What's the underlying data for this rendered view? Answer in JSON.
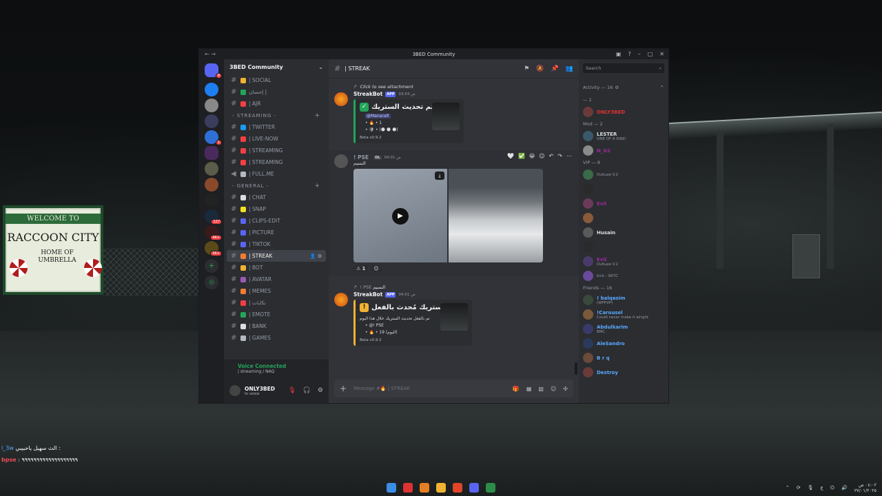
{
  "window": {
    "title": "3BED Community"
  },
  "background_sign": {
    "welcome": "WELCOME TO",
    "city": "RACCOON CITY",
    "home": "HOME OF UMBRELLA"
  },
  "channels": {
    "server_name": "3BED Community",
    "items": [
      {
        "kind": "channel",
        "label": "| SOCIAL",
        "color": "#f0b232"
      },
      {
        "kind": "channel",
        "label": "إحسان |",
        "color": "#23a55a"
      },
      {
        "kind": "channel",
        "label": "| AJR",
        "color": "#f23f43"
      },
      {
        "kind": "category",
        "label": "- STREAMING -"
      },
      {
        "kind": "channel",
        "label": "| TWITTER",
        "color": "#1d9bf0"
      },
      {
        "kind": "channel",
        "label": "| LIVE-NOW",
        "color": "#f23f43"
      },
      {
        "kind": "channel",
        "label": "| STREAMING",
        "color": "#f23f43"
      },
      {
        "kind": "channel",
        "label": "| STREAMING",
        "color": "#f23f43"
      },
      {
        "kind": "voice",
        "label": "| FULL.ME",
        "color": "#b5bac1"
      },
      {
        "kind": "category",
        "label": "- GENERAL -"
      },
      {
        "kind": "channel",
        "label": "| CHAT",
        "color": "#dbdee1"
      },
      {
        "kind": "channel",
        "label": "| SNAP",
        "color": "#f0e020"
      },
      {
        "kind": "channel",
        "label": "| CLIPS-EDIT",
        "color": "#5865f2"
      },
      {
        "kind": "channel",
        "label": "| PICTURE",
        "color": "#5865f2"
      },
      {
        "kind": "channel",
        "label": "| TIKTOK",
        "color": "#5865f2"
      },
      {
        "kind": "channel",
        "label": "| STREAK",
        "color": "#f07d32",
        "active": true
      },
      {
        "kind": "channel",
        "label": "| BOT",
        "color": "#f0b232"
      },
      {
        "kind": "channel",
        "label": "| AVATAR",
        "color": "#9b59b6"
      },
      {
        "kind": "channel",
        "label": "| MEMES",
        "color": "#f07d32"
      },
      {
        "kind": "channel",
        "label": "| نكايات",
        "color": "#f23f43"
      },
      {
        "kind": "channel",
        "label": "| EMOTE",
        "color": "#23a55a"
      },
      {
        "kind": "channel",
        "label": "| BANK",
        "color": "#dbdee1"
      },
      {
        "kind": "channel",
        "label": "| GAMES",
        "color": "#b5bac1"
      }
    ]
  },
  "voice": {
    "status": "Voice Connected",
    "location": "| streaming / NAQ"
  },
  "user": {
    "name": "ONLY3BED",
    "status": "In voice"
  },
  "header": {
    "channel": "| STREAK",
    "search_placeholder": "Search"
  },
  "messages": {
    "m1": {
      "reply_text": "Click to see attachment",
      "author": "StreakBot",
      "tag": "APP",
      "time": "03:54 ص",
      "embed_title": "تم تحديث الستريك •",
      "line1": "@Manaralt",
      "line2": "• 🔥 • 1",
      "line3": "• 🛡 • (🌑 🌑 🌑)",
      "footer": "Beta v0.9.2"
    },
    "m2": {
      "author": "! PSE",
      "badge": "OL",
      "time": "04:01 ص",
      "sub": "النسيم",
      "reaction_count": "1"
    },
    "m3": {
      "reply_text": "النسيم",
      "reply_author": "! PSE",
      "author": "StreakBot",
      "tag": "APP",
      "time": "04:01 ص",
      "embed_title": "الستريك مُحدث بالفعل •",
      "intro": "تم بالفعل تحديث الستريك خلال هذا اليوم",
      "line1": "• @! PSE",
      "line2": "• 🔥 • 19 (اليوم)",
      "footer": "Beta v0.9.2"
    }
  },
  "composer": {
    "placeholder": "Message #🔥 | STREAK"
  },
  "members": {
    "activity_header": "Activity — 16",
    "groups": [
      {
        "label": "— 1",
        "members": [
          {
            "name": "ONLY3BED",
            "color": "#e03232",
            "sub": ""
          }
        ]
      },
      {
        "label": "Mod — 2",
        "members": [
          {
            "name": "LESTER",
            "color": "#dbdee1",
            "sub": "ONE OF A KIND"
          },
          {
            "name": "N_G2",
            "color": "#9b2a9b",
            "sub": ""
          }
        ]
      },
      {
        "label": "VIP — 8",
        "members": [
          {
            "name": "",
            "color": "#9b2a9b",
            "sub": "OutLaw V.2"
          },
          {
            "name": "",
            "color": "#9b2a9b",
            "sub": ""
          },
          {
            "name": "Evil",
            "color": "#9b2a9b",
            "sub": ""
          },
          {
            "name": "",
            "color": "#9b2a9b",
            "sub": ""
          },
          {
            "name": "Husain",
            "color": "#dbdee1",
            "sub": ""
          },
          {
            "name": "",
            "color": "#9b2a9b",
            "sub": ""
          },
          {
            "name": "Evil",
            "color": "#9b2a9b",
            "sub": "OutLaw V.2"
          },
          {
            "name": "",
            "color": "#9b2a9b",
            "sub": "kick : SR7C"
          }
        ]
      },
      {
        "label": "Friends — 16",
        "members": [
          {
            "name": "! balqasim",
            "color": "#5aa8ff",
            "sub": "(WFPVP)"
          },
          {
            "name": "!Carousel",
            "color": "#5aa8ff",
            "sub": "Could never make it alright"
          },
          {
            "name": "Abdulkarim",
            "color": "#5aa8ff",
            "sub": "BMC"
          },
          {
            "name": "AleSandro",
            "color": "#5aa8ff",
            "sub": ""
          },
          {
            "name": "B r q",
            "color": "#5aa8ff",
            "sub": ""
          },
          {
            "name": "Destroy",
            "color": "#5aa8ff",
            "sub": ""
          }
        ]
      }
    ]
  },
  "overlay_chat": {
    "line1_user": "l_3w",
    "line1_text": "الث سهيل ياحبيبي :",
    "line2_user": "bpse",
    "line2_text": ": ٩٩٩٩٩٩٩٩٩٩٩٩٩٩٩٩٩٩٩"
  },
  "tray": {
    "time": "٠٤:٠٢ ص",
    "date": "٢٧/٠١/٢٠٢٥",
    "lang": "ع"
  }
}
